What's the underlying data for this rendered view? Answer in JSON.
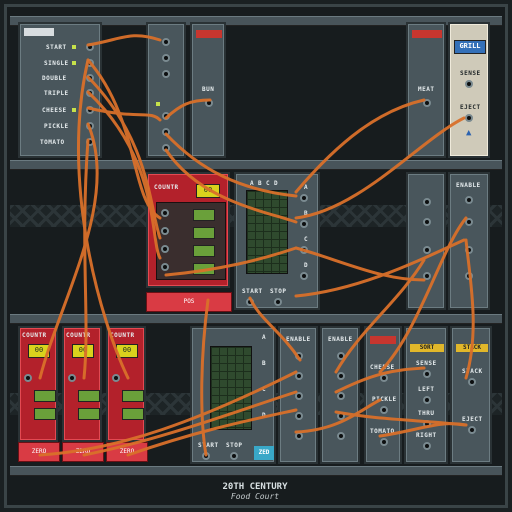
{
  "input_panel": {
    "labels": [
      "START",
      "SINGLE",
      "DOUBLE",
      "TRIPLE",
      "CHEESE",
      "PICKLE",
      "TOMATO"
    ]
  },
  "top_modules": {
    "bun": "BUN",
    "meat": "MEAT",
    "grill": {
      "title": "GRILL",
      "sense": "SENSE",
      "eject": "EJECT"
    }
  },
  "counter_center": {
    "title": "COUNTR",
    "display": "00",
    "pos": "POS"
  },
  "sequencer_upper": {
    "cols": [
      "A",
      "B",
      "C",
      "D"
    ],
    "rows": [
      "A",
      "B",
      "C",
      "D"
    ],
    "start": "START",
    "stop": "STOP"
  },
  "enable_right_upper": {
    "label": "ENABLE"
  },
  "counters_lower": [
    {
      "title": "COUNTR",
      "display": "00",
      "zero": "ZERO"
    },
    {
      "title": "COUNTR",
      "display": "00",
      "zero": "ZERO"
    },
    {
      "title": "COUNTR",
      "display": "00",
      "zero": "ZERO"
    }
  ],
  "sequencer_lower": {
    "rows": [
      "A",
      "B",
      "C",
      "D"
    ],
    "start": "START",
    "stop": "STOP",
    "zero": "ZED"
  },
  "enable_lower": [
    "ENABLE",
    "ENABLE"
  ],
  "toppings": {
    "cheese": "CHEESE",
    "pickle": "PICKLE",
    "tomato": "TOMATO"
  },
  "sort": {
    "title": "SORT",
    "sense": "SENSE",
    "left": "LEFT",
    "thru": "THRU",
    "right": "RIGHT"
  },
  "stack": {
    "title": "STACK",
    "stack": "STACK",
    "eject": "EJECT"
  },
  "branding": {
    "line1": "20TH CENTURY",
    "line2": "Food Court"
  }
}
